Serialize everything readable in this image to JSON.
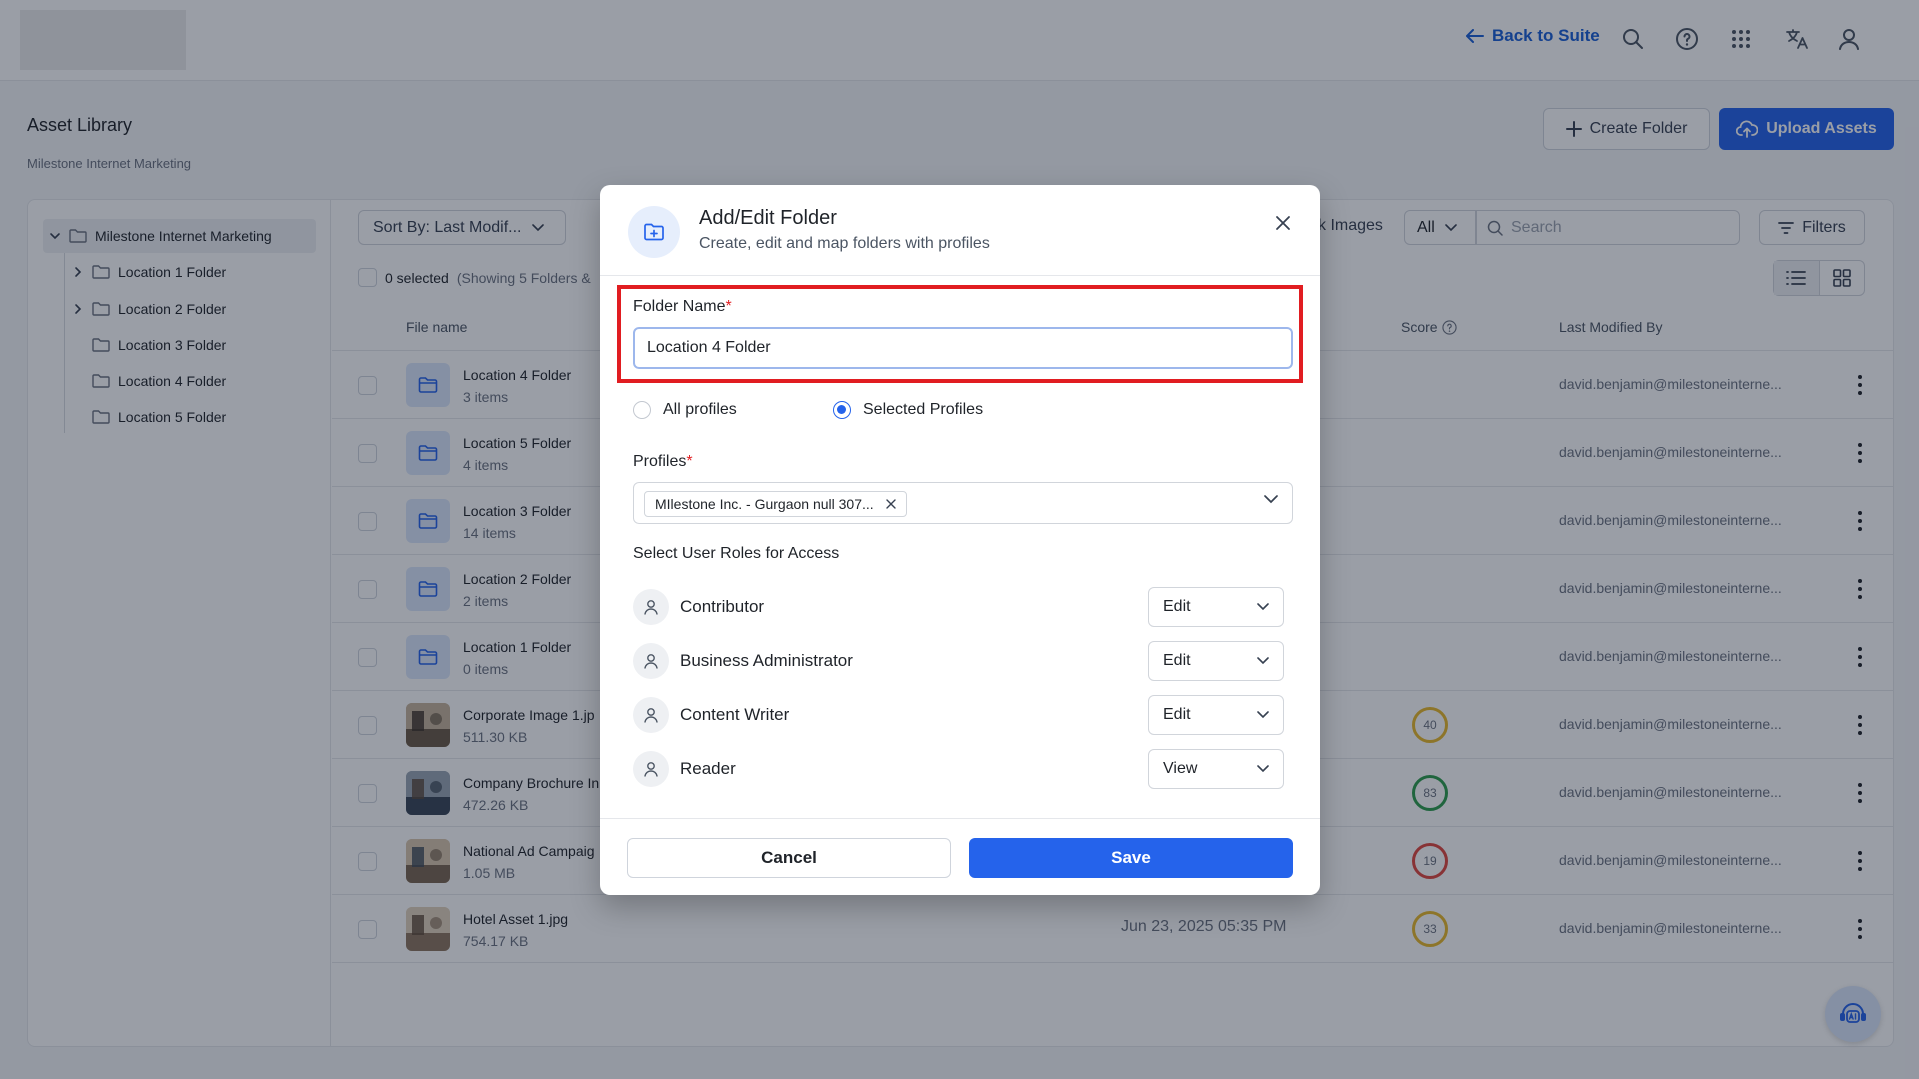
{
  "topbar": {
    "back_label": "Back to Suite",
    "icons": [
      "search-icon",
      "help-icon",
      "apps-grid-icon",
      "translate-icon",
      "user-icon"
    ]
  },
  "header": {
    "title": "Asset Library",
    "subtitle": "Milestone Internet Marketing",
    "create_folder_label": "Create Folder",
    "upload_label": "Upload Assets"
  },
  "sidebar": {
    "root": "Milestone Internet Marketing",
    "items": [
      {
        "label": "Location 1 Folder",
        "expandable": true
      },
      {
        "label": "Location 2 Folder",
        "expandable": true
      },
      {
        "label": "Location 3 Folder",
        "expandable": false
      },
      {
        "label": "Location 4 Folder",
        "expandable": false
      },
      {
        "label": "Location 5 Folder",
        "expandable": false
      }
    ]
  },
  "toolbar": {
    "sort_label": "Sort By: Last Modif...",
    "selected_label": "0 selected",
    "showing_label": "(Showing 5 Folders &",
    "images_link": "k Images",
    "filter_all": "All",
    "search_placeholder": "Search",
    "filters_label": "Filters"
  },
  "table": {
    "columns": {
      "file_name": "File name",
      "score": "Score",
      "last_modified_by": "Last Modified By"
    },
    "rows": [
      {
        "name": "Location 4 Folder",
        "meta": "3 items",
        "type": "folder",
        "date": "",
        "score": "",
        "modified_by": "david.benjamin@milestoneinterne..."
      },
      {
        "name": "Location 5 Folder",
        "meta": "4 items",
        "type": "folder",
        "date": "",
        "score": "",
        "modified_by": "david.benjamin@milestoneinterne..."
      },
      {
        "name": "Location 3 Folder",
        "meta": "14 items",
        "type": "folder",
        "date": "",
        "score": "",
        "modified_by": "david.benjamin@milestoneinterne..."
      },
      {
        "name": "Location 2 Folder",
        "meta": "2 items",
        "type": "folder",
        "date": "",
        "score": "",
        "modified_by": "david.benjamin@milestoneinterne..."
      },
      {
        "name": "Location 1 Folder",
        "meta": "0 items",
        "type": "folder",
        "date": "",
        "score": "",
        "modified_by": "david.benjamin@milestoneinterne..."
      },
      {
        "name": "Corporate Image 1.jp",
        "meta": "511.30 KB",
        "type": "image",
        "date": "",
        "score": "40",
        "modified_by": "david.benjamin@milestoneinterne..."
      },
      {
        "name": "Company Brochure In",
        "meta": "472.26 KB",
        "type": "image",
        "date": "",
        "score": "83",
        "modified_by": "david.benjamin@milestoneinterne..."
      },
      {
        "name": "National Ad Campaig",
        "meta": "1.05 MB",
        "type": "image",
        "date": "",
        "score": "19",
        "modified_by": "david.benjamin@milestoneinterne..."
      },
      {
        "name": "Hotel Asset 1.jpg",
        "meta": "754.17 KB",
        "type": "image",
        "date": "Jun 23, 2025 05:35 PM",
        "score": "33",
        "modified_by": "david.benjamin@milestoneinterne..."
      }
    ]
  },
  "modal": {
    "title": "Add/Edit Folder",
    "subtitle": "Create, edit and map folders with profiles",
    "folder_name_label": "Folder Name",
    "required_mark": "*",
    "folder_name_value": "Location 4 Folder",
    "radio_all": "All profiles",
    "radio_selected": "Selected Profiles",
    "radio_selected_value": "Selected Profiles",
    "profiles_label": "Profiles",
    "profile_chip": "MIlestone Inc. - Gurgaon null 307...",
    "roles_heading": "Select User Roles for Access",
    "roles": [
      {
        "name": "Contributor",
        "access": "Edit"
      },
      {
        "name": "Business Administrator",
        "access": "Edit"
      },
      {
        "name": "Content Writer",
        "access": "Edit"
      },
      {
        "name": "Reader",
        "access": "View"
      }
    ],
    "cancel_label": "Cancel",
    "save_label": "Save"
  },
  "colors": {
    "accent": "#2563eb",
    "highlight": "#e11d21",
    "score_yellow": "#e8b92a",
    "score_green": "#2e9d4c",
    "score_red": "#e0483e"
  }
}
